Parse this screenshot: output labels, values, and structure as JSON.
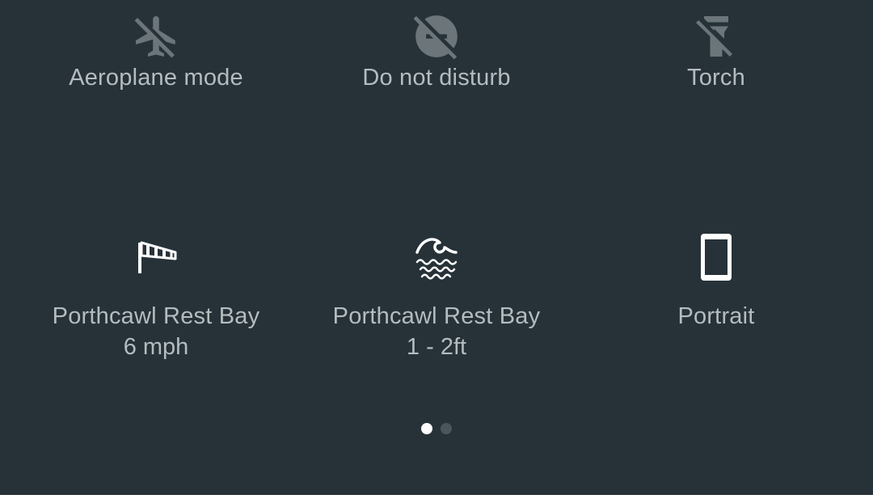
{
  "tiles": [
    {
      "label": "Aeroplane mode",
      "icon": "airplane-off-icon",
      "state": "off"
    },
    {
      "label": "Do not disturb",
      "icon": "do-not-disturb-off-icon",
      "state": "off"
    },
    {
      "label": "Torch",
      "icon": "flashlight-off-icon",
      "state": "off"
    },
    {
      "label": "Porthcawl Rest Bay",
      "sublabel": "6 mph",
      "icon": "windsock-icon",
      "state": "on"
    },
    {
      "label": "Porthcawl Rest Bay",
      "sublabel": "1 - 2ft",
      "icon": "wave-icon",
      "state": "on"
    },
    {
      "label": "Portrait",
      "icon": "phone-portrait-icon",
      "state": "on"
    }
  ],
  "pager": {
    "pages": 2,
    "current": 1
  },
  "colors": {
    "background": "#263238",
    "label": "#b5bcc0",
    "icon_off": "#6b757a",
    "icon_on": "#ffffff",
    "dot_active": "#ffffff",
    "dot_inactive": "#4a565c"
  }
}
